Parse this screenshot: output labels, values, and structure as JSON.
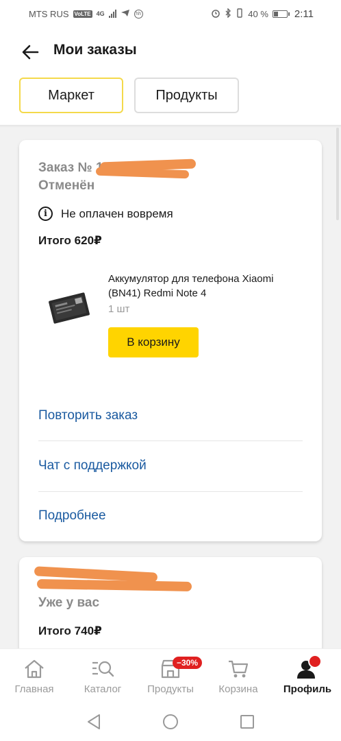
{
  "status_bar": {
    "carrier": "MTS RUS",
    "volte": "VoLTE",
    "network": "4G",
    "battery": "40 %",
    "battery_level": 0.4,
    "time": "2:11"
  },
  "header": {
    "title": "Мои заказы",
    "tabs": [
      {
        "label": "Маркет",
        "active": true
      },
      {
        "label": "Продукты",
        "active": false
      }
    ]
  },
  "orders": [
    {
      "number_label": "Заказ № 16",
      "status": "Отменён",
      "info": "Не оплачен вовремя",
      "total": "Итого 620₽",
      "product": {
        "title": "Аккумулятор для телефона Xiaomi (BN41) Redmi Note 4",
        "qty": "1 шт",
        "cart_button": "В корзину"
      },
      "actions": {
        "repeat": "Повторить заказ",
        "chat": "Чат с поддержкой",
        "details": "Подробнее"
      }
    },
    {
      "status": "Уже у вас",
      "total": "Итого 740₽"
    }
  ],
  "bottom_nav": {
    "items": [
      {
        "label": "Главная",
        "icon": "home-icon"
      },
      {
        "label": "Каталог",
        "icon": "catalog-search-icon"
      },
      {
        "label": "Продукты",
        "icon": "shop-icon",
        "badge": "−30%"
      },
      {
        "label": "Корзина",
        "icon": "cart-icon"
      },
      {
        "label": "Профиль",
        "icon": "profile-icon",
        "active": true
      }
    ]
  },
  "colors": {
    "accent_yellow": "#ffd400",
    "link_blue": "#1a5aa0",
    "badge_red": "#e02020",
    "redaction_orange": "#f0924e"
  }
}
